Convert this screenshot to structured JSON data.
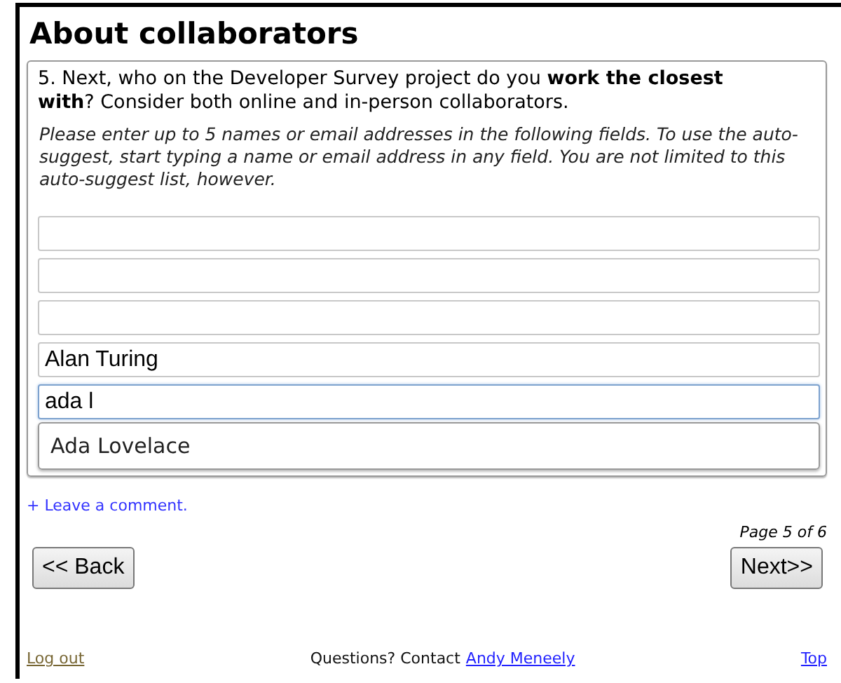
{
  "title": "About collaborators",
  "question": "5. Next, who on the Developer Survey project do you **work the closest with**? Consider both online and in-person collaborators.",
  "instructions": "Please enter up to 5 names or email addresses in the following fields. To use the auto-suggest, start typing a name or email address in any field. You are not limited to this auto-suggest list, however.",
  "fields": [
    {
      "focused": false
    },
    {
      "focused": false
    },
    {
      "focused": false
    },
    {
      "value": "Alan Turing",
      "focused": false
    },
    {
      "value": "ada l",
      "focused": true
    }
  ],
  "suggestions": [
    "Ada Lovelace"
  ],
  "comment_link": "+ Leave a comment.",
  "page_indicator": "Page 5 of 6",
  "buttons": {
    "back": "<< Back",
    "next": "Next>>"
  },
  "footer": {
    "logout": "Log out",
    "contact_text": "Questions? Contact",
    "contact_link": "Andy Meneely",
    "top": "Top"
  }
}
